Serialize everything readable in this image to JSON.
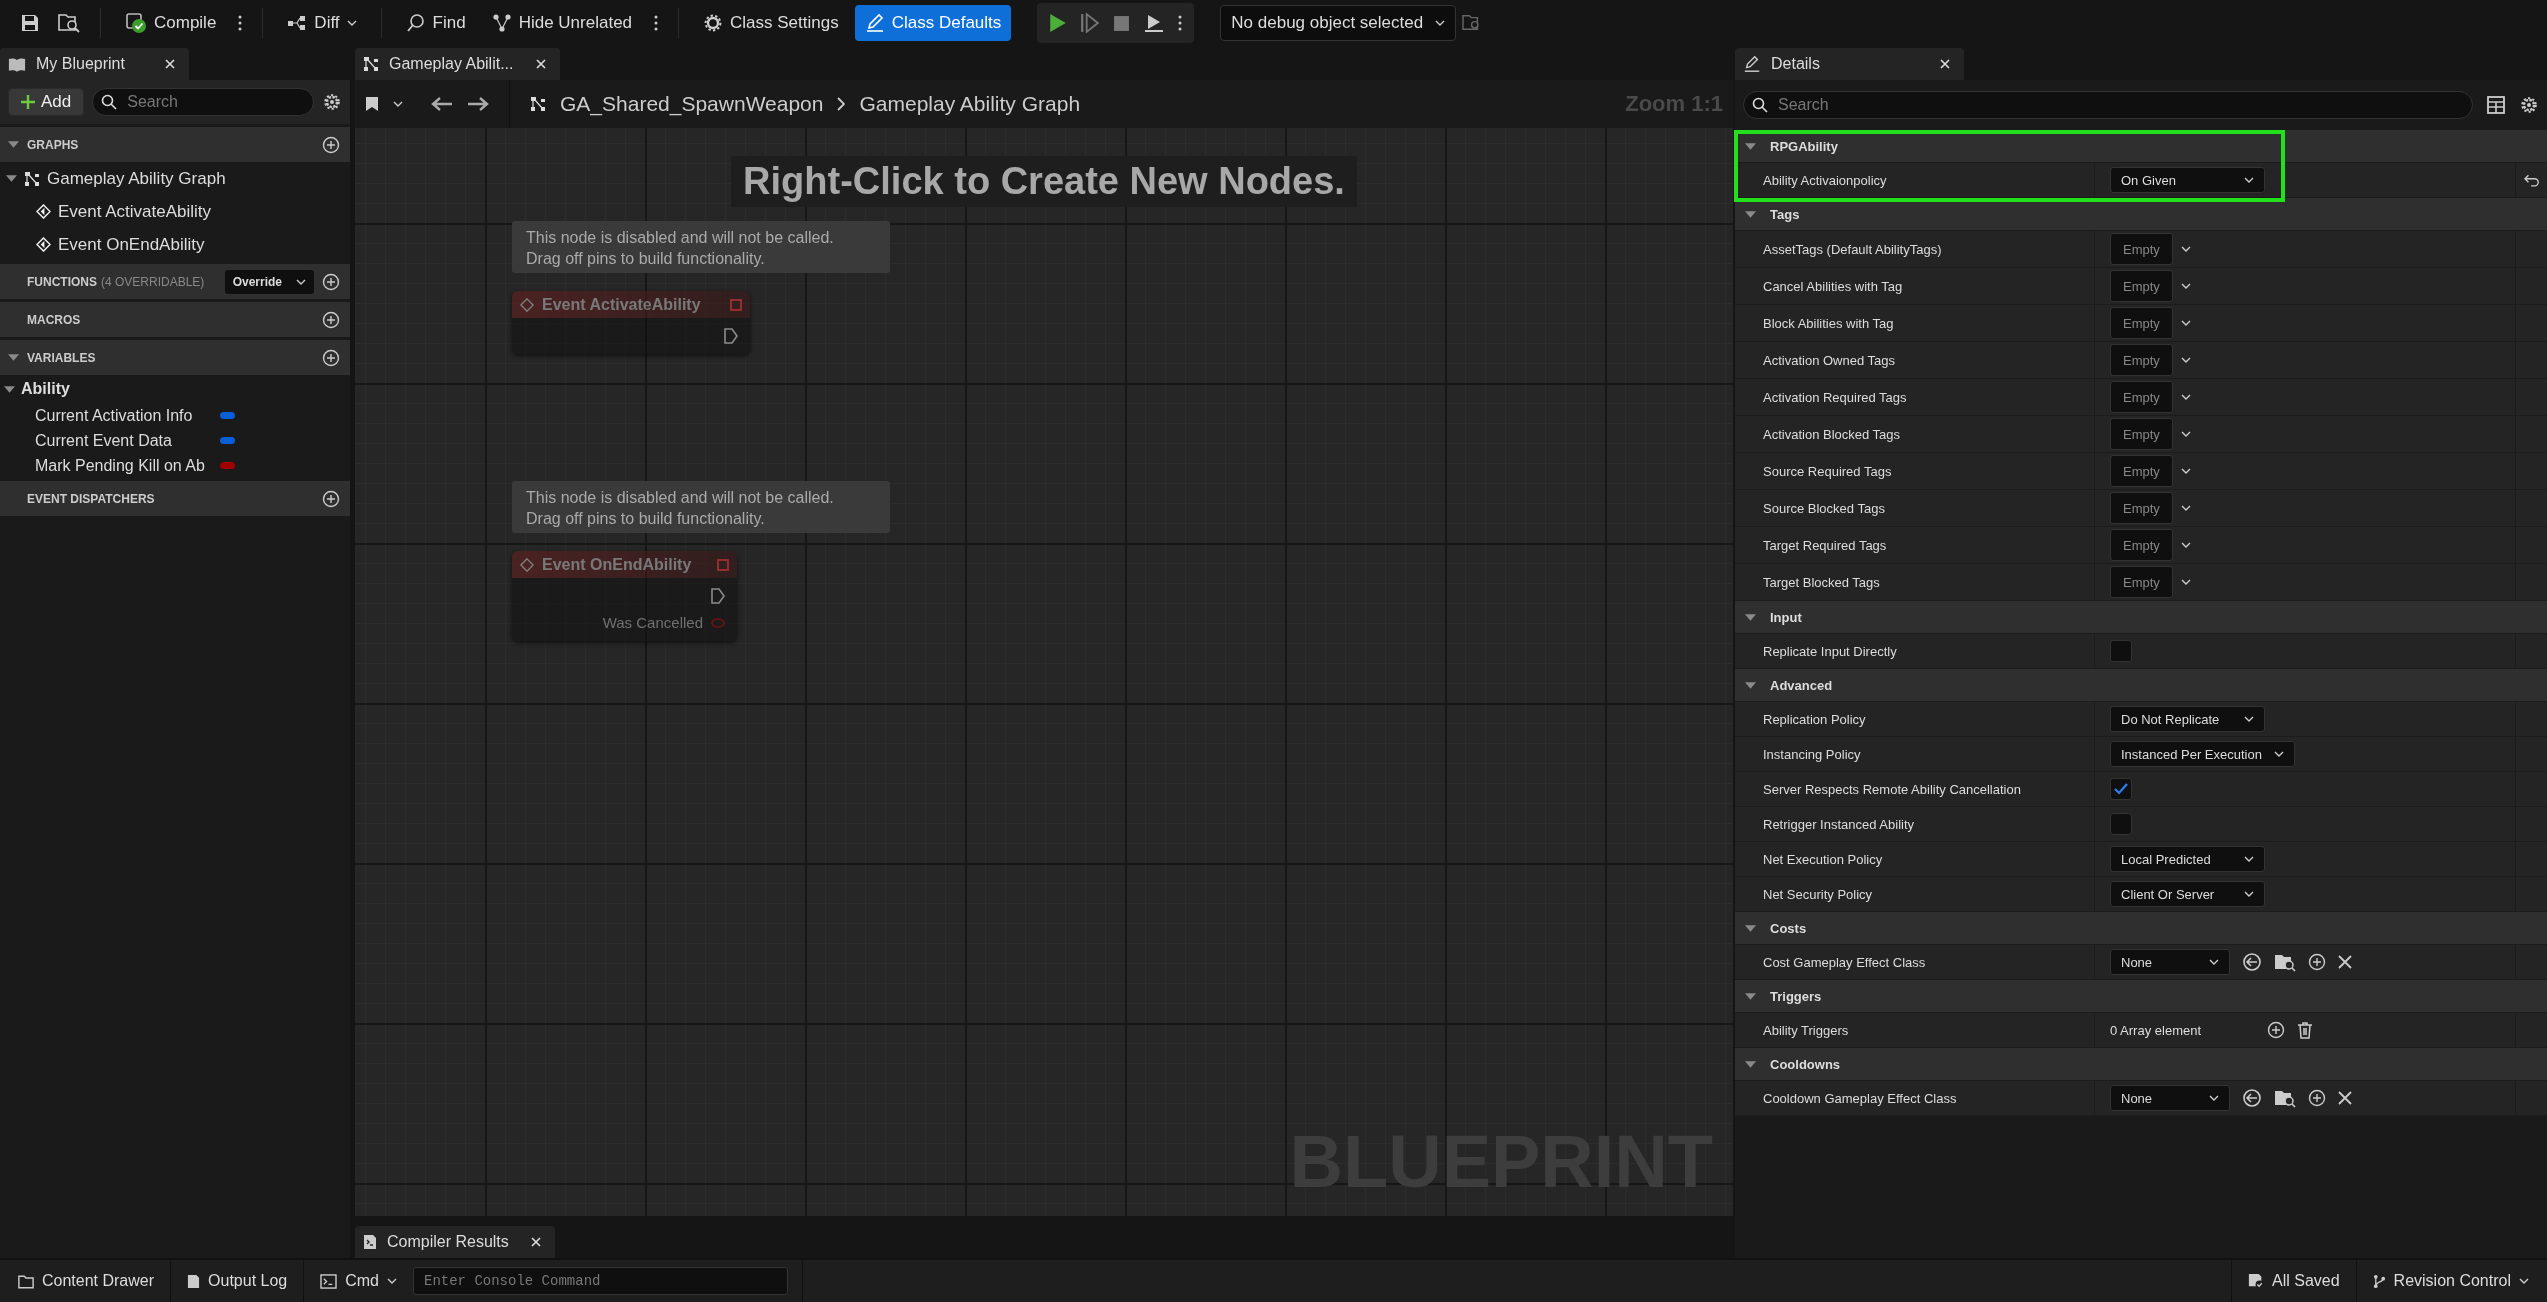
{
  "toolbar": {
    "buttons": [
      {
        "label": "Compile",
        "selected": false,
        "menu": true
      },
      {
        "label": "Diff",
        "selected": false,
        "menu": false
      },
      {
        "label": "Find",
        "selected": false,
        "menu": false
      },
      {
        "label": "Hide Unrelated",
        "selected": false,
        "menu": true
      },
      {
        "label": "Class Settings",
        "selected": false,
        "menu": false
      },
      {
        "label": "Class Defaults",
        "selected": true,
        "menu": false
      }
    ],
    "debug_object": "No debug object selected"
  },
  "my_blueprint": {
    "tab": "My Blueprint",
    "add_button": "Add",
    "search": {
      "placeholder": "Search"
    },
    "sections": [
      {
        "title": "GRAPHS",
        "expanded": true,
        "items": [
          {
            "label": "Gameplay Ability Graph",
            "kind": "graph",
            "children": [
              {
                "label": "Event ActivateAbility",
                "kind": "event"
              },
              {
                "label": "Event OnEndAbility",
                "kind": "event"
              }
            ]
          }
        ]
      },
      {
        "title": "FUNCTIONS",
        "note": "(4 OVERRIDABLE)",
        "dropdown": "Override",
        "expanded": false
      },
      {
        "title": "MACROS",
        "expanded": false
      },
      {
        "title": "VARIABLES",
        "expanded": true,
        "items": [
          {
            "label": "Ability",
            "kind": "category",
            "children": [
              {
                "label": "Current Activation Info",
                "kind": "variable",
                "color": "#0a5ed8"
              },
              {
                "label": "Current Event Data",
                "kind": "variable",
                "color": "#0a5ed8"
              },
              {
                "label": "Mark Pending Kill on Ab",
                "kind": "variable",
                "color": "#a00000"
              }
            ]
          }
        ]
      },
      {
        "title": "EVENT DISPATCHERS",
        "expanded": false
      }
    ]
  },
  "graph": {
    "tab": "Gameplay Abilit...",
    "breadcrumb": [
      "GA_Shared_SpawnWeapon",
      "Gameplay Ability Graph"
    ],
    "zoom": "Zoom 1:1",
    "hint": "Right-Click to Create New Nodes.",
    "nodes": [
      {
        "title": "Event ActivateAbility",
        "disabled": true,
        "comment": [
          "This node is disabled and will not be called.",
          "Drag off pins to build functionality."
        ]
      },
      {
        "title": "Event OnEndAbility",
        "disabled": true,
        "comment": [
          "This node is disabled and will not be called.",
          "Drag off pins to build functionality."
        ],
        "pins": [
          "Was Cancelled"
        ]
      }
    ],
    "watermark": "BLUEPRINT",
    "bottom_tab": "Compiler Results"
  },
  "details": {
    "tab": "Details",
    "search": {
      "placeholder": "Search"
    },
    "categories": [
      {
        "name": "RPGAbility",
        "highlighted": true,
        "rows": [
          {
            "label": "Ability Activaionpolicy",
            "kind": "dropdown",
            "value": "On Given",
            "modified": true
          }
        ]
      },
      {
        "name": "Tags",
        "highlighted": false,
        "rows": [
          {
            "label": "AssetTags (Default AbilityTags)",
            "kind": "tags",
            "value": "Empty",
            "modified": false
          },
          {
            "label": "Cancel Abilities with Tag",
            "kind": "tags",
            "value": "Empty",
            "modified": false
          },
          {
            "label": "Block Abilities with Tag",
            "kind": "tags",
            "value": "Empty",
            "modified": false
          },
          {
            "label": "Activation Owned Tags",
            "kind": "tags",
            "value": "Empty",
            "modified": false
          },
          {
            "label": "Activation Required Tags",
            "kind": "tags",
            "value": "Empty",
            "modified": false
          },
          {
            "label": "Activation Blocked Tags",
            "kind": "tags",
            "value": "Empty",
            "modified": false
          },
          {
            "label": "Source Required Tags",
            "kind": "tags",
            "value": "Empty",
            "modified": false
          },
          {
            "label": "Source Blocked Tags",
            "kind": "tags",
            "value": "Empty",
            "modified": false
          },
          {
            "label": "Target Required Tags",
            "kind": "tags",
            "value": "Empty",
            "modified": false
          },
          {
            "label": "Target Blocked Tags",
            "kind": "tags",
            "value": "Empty",
            "modified": false
          }
        ]
      },
      {
        "name": "Input",
        "highlighted": false,
        "rows": [
          {
            "label": "Replicate Input Directly",
            "kind": "checkbox",
            "checked": false,
            "modified": false
          }
        ]
      },
      {
        "name": "Advanced",
        "highlighted": false,
        "rows": [
          {
            "label": "Replication Policy",
            "kind": "dropdown",
            "value": "Do Not Replicate",
            "modified": false
          },
          {
            "label": "Instancing Policy",
            "kind": "dropdown",
            "value": "Instanced Per Execution",
            "modified": false
          },
          {
            "label": "Server Respects Remote Ability Cancellation",
            "kind": "checkbox",
            "checked": true,
            "modified": false
          },
          {
            "label": "Retrigger Instanced Ability",
            "kind": "checkbox",
            "checked": false,
            "modified": false
          },
          {
            "label": "Net Execution Policy",
            "kind": "dropdown",
            "value": "Local Predicted",
            "modified": false
          },
          {
            "label": "Net Security Policy",
            "kind": "dropdown",
            "value": "Client Or Server",
            "modified": false
          }
        ]
      },
      {
        "name": "Costs",
        "highlighted": false,
        "rows": [
          {
            "label": "Cost Gameplay Effect Class",
            "kind": "object",
            "value": "None",
            "modified": false
          }
        ]
      },
      {
        "name": "Triggers",
        "highlighted": false,
        "rows": [
          {
            "label": "Ability Triggers",
            "kind": "array",
            "value": "0 Array element",
            "modified": false
          }
        ]
      },
      {
        "name": "Cooldowns",
        "highlighted": false,
        "rows": [
          {
            "label": "Cooldown Gameplay Effect Class",
            "kind": "object",
            "value": "None",
            "modified": false
          }
        ]
      }
    ]
  },
  "status_bar": {
    "left": [
      "Content Drawer",
      "Output Log"
    ],
    "cmd": "Cmd",
    "console": {
      "placeholder": "Enter Console Command"
    },
    "right": [
      "All Saved",
      "Revision Control"
    ]
  }
}
